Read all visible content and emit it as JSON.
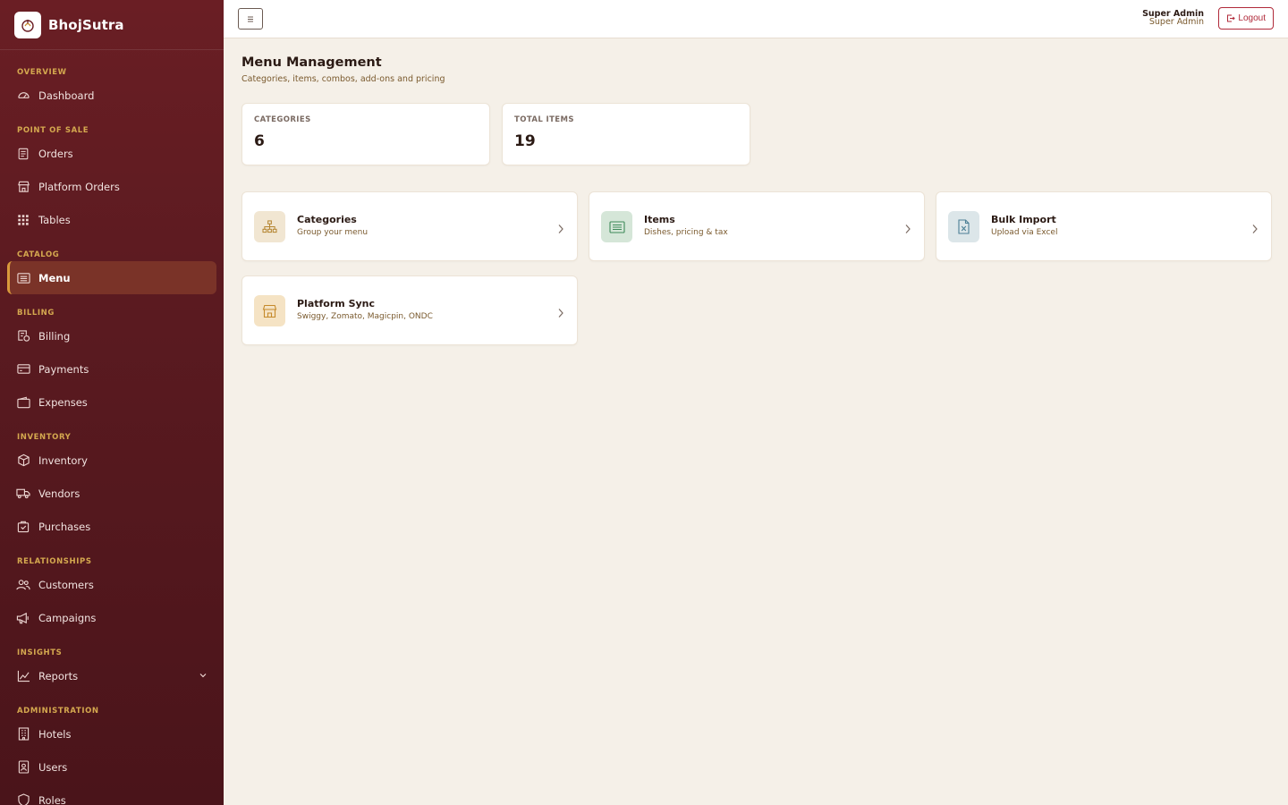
{
  "brand": {
    "name": "BhojSutra"
  },
  "sidebar": {
    "sections": {
      "overview": "OVERVIEW",
      "pos": "POINT OF SALE",
      "catalog": "CATALOG",
      "billing": "BILLING",
      "inventory": "INVENTORY",
      "relationships": "RELATIONSHIPS",
      "insights": "INSIGHTS",
      "administration": "ADMINISTRATION"
    },
    "items": {
      "dashboard": "Dashboard",
      "orders": "Orders",
      "platform_orders": "Platform Orders",
      "tables": "Tables",
      "menu": "Menu",
      "billing": "Billing",
      "payments": "Payments",
      "expenses": "Expenses",
      "inventory": "Inventory",
      "vendors": "Vendors",
      "purchases": "Purchases",
      "customers": "Customers",
      "campaigns": "Campaigns",
      "reports": "Reports",
      "hotels": "Hotels",
      "users": "Users",
      "roles": "Roles"
    },
    "active_item": "Menu"
  },
  "topbar": {
    "user_name": "Super Admin",
    "user_role": "Super Admin",
    "logout_label": "Logout"
  },
  "page": {
    "title": "Menu Management",
    "subtitle": "Categories, items, combos, add-ons and pricing"
  },
  "stats": [
    {
      "label": "CATEGORIES",
      "value": "6"
    },
    {
      "label": "TOTAL ITEMS",
      "value": "19"
    }
  ],
  "links": [
    {
      "title": "Categories",
      "subtitle": "Group your menu",
      "icon": "sitemap-icon"
    },
    {
      "title": "Items",
      "subtitle": "Dishes, pricing & tax",
      "icon": "list-icon"
    },
    {
      "title": "Bulk Import",
      "subtitle": "Upload via Excel",
      "icon": "excel-file-icon"
    },
    {
      "title": "Platform Sync",
      "subtitle": "Swiggy, Zomato, Magicpin, ONDC",
      "icon": "store-icon"
    }
  ],
  "colors": {
    "sidebar_bg": "#5a1a20",
    "accent": "#d99a3b",
    "page_bg": "#f5f0e8",
    "logout": "#b02a3a"
  }
}
